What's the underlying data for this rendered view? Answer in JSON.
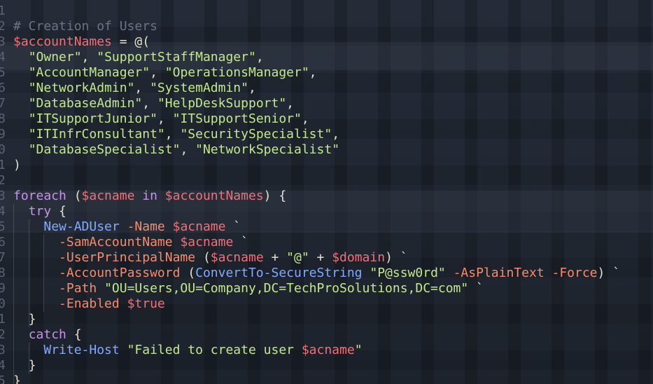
{
  "editor": {
    "lines": [
      {
        "n": "1",
        "tokens": []
      },
      {
        "n": "2",
        "tokens": [
          {
            "t": "# Creation of Users",
            "c": "comment"
          }
        ]
      },
      {
        "n": "3",
        "tokens": [
          {
            "t": "$accountNames",
            "c": "var"
          },
          {
            "t": " = @(",
            "c": "punc"
          }
        ]
      },
      {
        "n": "4",
        "tokens": [
          {
            "t": "  ",
            "c": "punc"
          },
          {
            "t": "\"Owner\"",
            "c": "str"
          },
          {
            "t": ", ",
            "c": "punc"
          },
          {
            "t": "\"SupportStaffManager\"",
            "c": "str"
          },
          {
            "t": ",",
            "c": "punc"
          }
        ]
      },
      {
        "n": "5",
        "tokens": [
          {
            "t": "  ",
            "c": "punc"
          },
          {
            "t": "\"AccountManager\"",
            "c": "str"
          },
          {
            "t": ", ",
            "c": "punc"
          },
          {
            "t": "\"OperationsManager\"",
            "c": "str"
          },
          {
            "t": ",",
            "c": "punc"
          }
        ]
      },
      {
        "n": "6",
        "tokens": [
          {
            "t": "  ",
            "c": "punc"
          },
          {
            "t": "\"NetworkAdmin\"",
            "c": "str"
          },
          {
            "t": ", ",
            "c": "punc"
          },
          {
            "t": "\"SystemAdmin\"",
            "c": "str"
          },
          {
            "t": ",",
            "c": "punc"
          }
        ]
      },
      {
        "n": "7",
        "tokens": [
          {
            "t": "  ",
            "c": "punc"
          },
          {
            "t": "\"DatabaseAdmin\"",
            "c": "str"
          },
          {
            "t": ", ",
            "c": "punc"
          },
          {
            "t": "\"HelpDeskSupport\"",
            "c": "str"
          },
          {
            "t": ",",
            "c": "punc"
          }
        ]
      },
      {
        "n": "8",
        "tokens": [
          {
            "t": "  ",
            "c": "punc"
          },
          {
            "t": "\"ITSupportJunior\"",
            "c": "str"
          },
          {
            "t": ", ",
            "c": "punc"
          },
          {
            "t": "\"ITSupportSenior\"",
            "c": "str"
          },
          {
            "t": ",",
            "c": "punc"
          }
        ]
      },
      {
        "n": "9",
        "tokens": [
          {
            "t": "  ",
            "c": "punc"
          },
          {
            "t": "\"ITInfrConsultant\"",
            "c": "str"
          },
          {
            "t": ", ",
            "c": "punc"
          },
          {
            "t": "\"SecuritySpecialist\"",
            "c": "str"
          },
          {
            "t": ",",
            "c": "punc"
          }
        ]
      },
      {
        "n": "0",
        "tokens": [
          {
            "t": "  ",
            "c": "punc"
          },
          {
            "t": "\"DatabaseSpecialist\"",
            "c": "str"
          },
          {
            "t": ", ",
            "c": "punc"
          },
          {
            "t": "\"NetworkSpecialist\"",
            "c": "str"
          }
        ]
      },
      {
        "n": "1",
        "tokens": [
          {
            "t": ")",
            "c": "punc"
          }
        ]
      },
      {
        "n": "2",
        "tokens": []
      },
      {
        "n": "3",
        "tokens": [
          {
            "t": "foreach",
            "c": "kw"
          },
          {
            "t": " (",
            "c": "punc"
          },
          {
            "t": "$acname",
            "c": "var"
          },
          {
            "t": " in ",
            "c": "kw"
          },
          {
            "t": "$accountNames",
            "c": "var"
          },
          {
            "t": ") {",
            "c": "punc"
          }
        ]
      },
      {
        "n": "4",
        "tokens": [
          {
            "t": "  ",
            "c": "punc"
          },
          {
            "t": "try",
            "c": "kw"
          },
          {
            "t": " {",
            "c": "punc"
          }
        ]
      },
      {
        "n": "5",
        "tokens": [
          {
            "t": "    ",
            "c": "punc"
          },
          {
            "t": "New-ADUser",
            "c": "cmd"
          },
          {
            "t": " ",
            "c": "punc"
          },
          {
            "t": "-Name",
            "c": "param"
          },
          {
            "t": " ",
            "c": "punc"
          },
          {
            "t": "$acname",
            "c": "var"
          },
          {
            "t": " `",
            "c": "punc"
          }
        ]
      },
      {
        "n": "6",
        "tokens": [
          {
            "t": "      ",
            "c": "punc"
          },
          {
            "t": "-SamAccountName",
            "c": "param"
          },
          {
            "t": " ",
            "c": "punc"
          },
          {
            "t": "$acname",
            "c": "var"
          },
          {
            "t": " `",
            "c": "punc"
          }
        ]
      },
      {
        "n": "7",
        "tokens": [
          {
            "t": "      ",
            "c": "punc"
          },
          {
            "t": "-UserPrincipalName",
            "c": "param"
          },
          {
            "t": " (",
            "c": "punc"
          },
          {
            "t": "$acname",
            "c": "var"
          },
          {
            "t": " + ",
            "c": "punc"
          },
          {
            "t": "\"@\"",
            "c": "str"
          },
          {
            "t": " + ",
            "c": "punc"
          },
          {
            "t": "$domain",
            "c": "var"
          },
          {
            "t": ") `",
            "c": "punc"
          }
        ]
      },
      {
        "n": "8",
        "tokens": [
          {
            "t": "      ",
            "c": "punc"
          },
          {
            "t": "-AccountPassword",
            "c": "param"
          },
          {
            "t": " (",
            "c": "punc"
          },
          {
            "t": "ConvertTo-SecureString",
            "c": "cmd"
          },
          {
            "t": " ",
            "c": "punc"
          },
          {
            "t": "\"P@ssw0rd\"",
            "c": "str"
          },
          {
            "t": " ",
            "c": "punc"
          },
          {
            "t": "-AsPlainText",
            "c": "param"
          },
          {
            "t": " ",
            "c": "punc"
          },
          {
            "t": "-Force",
            "c": "param"
          },
          {
            "t": ") `",
            "c": "punc"
          }
        ]
      },
      {
        "n": "9",
        "tokens": [
          {
            "t": "      ",
            "c": "punc"
          },
          {
            "t": "-Path",
            "c": "param"
          },
          {
            "t": " ",
            "c": "punc"
          },
          {
            "t": "\"OU=Users,OU=Company,DC=TechProSolutions,DC=com\"",
            "c": "str"
          },
          {
            "t": " `",
            "c": "punc"
          }
        ]
      },
      {
        "n": "0",
        "tokens": [
          {
            "t": "      ",
            "c": "punc"
          },
          {
            "t": "-Enabled",
            "c": "param"
          },
          {
            "t": " ",
            "c": "punc"
          },
          {
            "t": "$true",
            "c": "var"
          }
        ]
      },
      {
        "n": "1",
        "tokens": [
          {
            "t": "  }",
            "c": "punc"
          }
        ]
      },
      {
        "n": "2",
        "tokens": [
          {
            "t": "  ",
            "c": "punc"
          },
          {
            "t": "catch",
            "c": "kw"
          },
          {
            "t": " {",
            "c": "punc"
          }
        ]
      },
      {
        "n": "3",
        "tokens": [
          {
            "t": "    ",
            "c": "punc"
          },
          {
            "t": "Write-Host",
            "c": "cmd"
          },
          {
            "t": " ",
            "c": "punc"
          },
          {
            "t": "\"Failed to create user ",
            "c": "str"
          },
          {
            "t": "$acname",
            "c": "var"
          },
          {
            "t": "\"",
            "c": "str"
          }
        ]
      },
      {
        "n": "4",
        "tokens": [
          {
            "t": "  }",
            "c": "punc"
          }
        ]
      },
      {
        "n": "5",
        "tokens": [
          {
            "t": "}",
            "c": "punc"
          }
        ]
      }
    ]
  },
  "colors": {
    "background": "#1c2029",
    "comment": "#6b7385",
    "variable": "#f07178",
    "string": "#c3e88d",
    "keyword": "#c792ea",
    "command": "#82aaff",
    "parameter": "#f78c6c",
    "line_number": "#5a6273"
  }
}
